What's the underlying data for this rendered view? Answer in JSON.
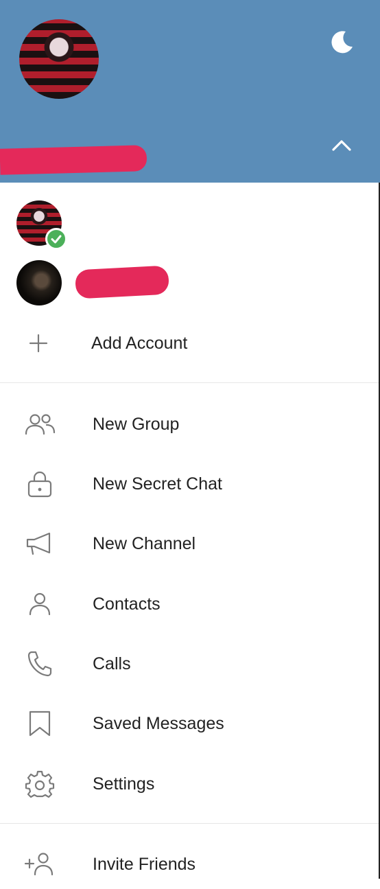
{
  "header": {
    "background_color": "#5b8db8",
    "theme_icon": "moon-icon",
    "expand_icon": "chevron-up-icon"
  },
  "accounts": [
    {
      "avatar": "profile-avatar",
      "status": "check-icon"
    },
    {
      "avatar": "account-avatar"
    }
  ],
  "add_account": {
    "icon": "plus-icon",
    "label": "Add Account"
  },
  "menu": {
    "items": [
      {
        "icon": "group-icon",
        "label": "New Group"
      },
      {
        "icon": "lock-icon",
        "label": "New Secret Chat"
      },
      {
        "icon": "megaphone-icon",
        "label": "New Channel"
      },
      {
        "icon": "person-icon",
        "label": "Contacts"
      },
      {
        "icon": "phone-icon",
        "label": "Calls"
      },
      {
        "icon": "bookmark-icon",
        "label": "Saved Messages"
      },
      {
        "icon": "gear-icon",
        "label": "Settings"
      }
    ]
  },
  "footer_menu": {
    "items": [
      {
        "icon": "add-person-icon",
        "label": "Invite Friends"
      }
    ]
  },
  "colors": {
    "accent": "#5b8db8",
    "online_badge": "#4cb05a",
    "text": "#222222",
    "icon": "#7a7a7a"
  }
}
